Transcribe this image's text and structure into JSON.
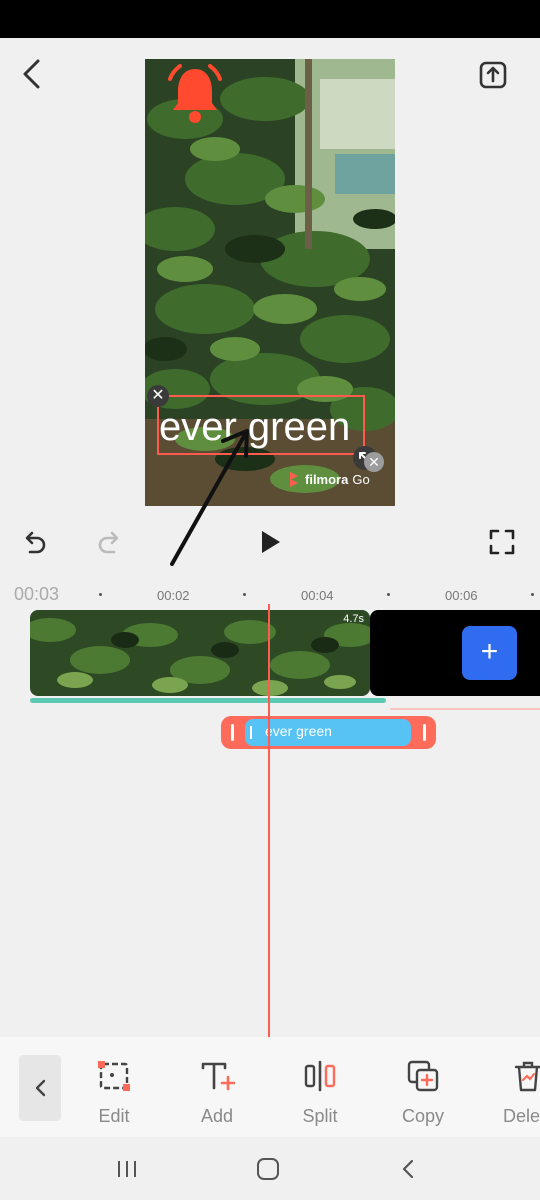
{
  "header": {
    "back_icon": "chevron-left-icon",
    "export_icon": "export-upload-icon"
  },
  "preview": {
    "overlay_text": "ever green",
    "watermark": {
      "brand": "filmora",
      "suffix": "Go"
    },
    "alert_icon": "bell-icon",
    "delete_handle_glyph": "✕",
    "watermark_close_glyph": "✕"
  },
  "controls": {
    "undo_icon": "undo-icon",
    "redo_icon": "redo-icon",
    "play_icon": "play-icon",
    "fullscreen_icon": "fullscreen-icon"
  },
  "timeline": {
    "current_time": "00:03",
    "ticks": [
      "00:02",
      "00:04",
      "00:06"
    ],
    "clip_duration": "4.7s",
    "add_clip_label": "+",
    "text_clip_label": "ever green",
    "colors": {
      "playhead": "#ff5b4f",
      "text_clip": "#ff6b5b",
      "text_clip_inner": "#57c3f5",
      "add_button": "#2f6cf0",
      "progress": "#5ec9b3"
    }
  },
  "toolbar": {
    "items": [
      {
        "label": "Edit",
        "icon": "edit-frame-icon"
      },
      {
        "label": "Add",
        "icon": "add-text-icon"
      },
      {
        "label": "Split",
        "icon": "split-icon"
      },
      {
        "label": "Copy",
        "icon": "copy-icon"
      },
      {
        "label": "Delete",
        "icon": "delete-icon"
      }
    ]
  },
  "navbar": {
    "recents_icon": "recents-icon",
    "home_icon": "home-icon",
    "back_icon": "back-icon"
  }
}
